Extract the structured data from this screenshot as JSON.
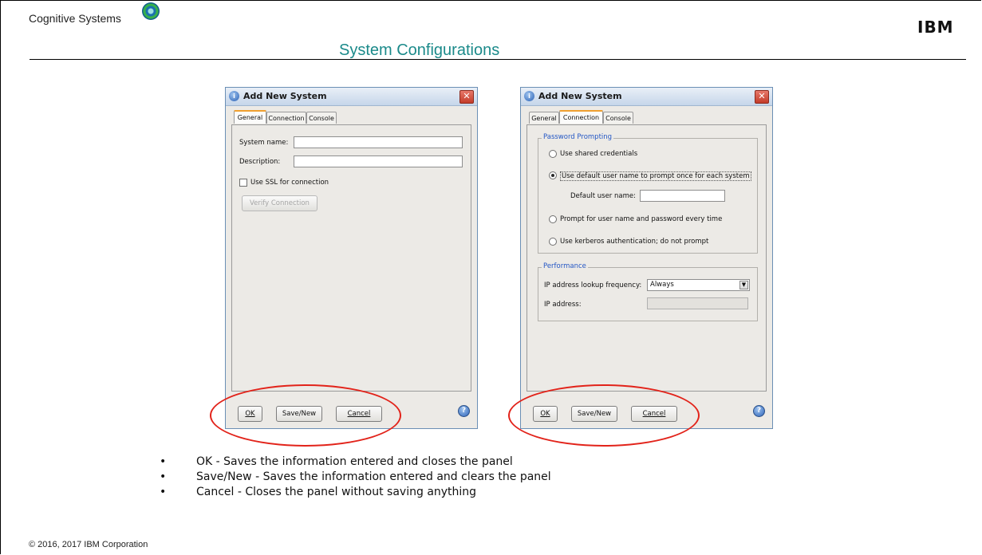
{
  "header": {
    "brand": "Cognitive Systems",
    "title": "System Configurations",
    "logo_text": "IBM"
  },
  "footer": {
    "copyright": "© 2016, 2017 IBM Corporation"
  },
  "dialogs": [
    {
      "title": "Add New System",
      "close_glyph": "✕",
      "tabs": [
        "General",
        "Connection",
        "Console"
      ],
      "active_tab": "General",
      "fields": {
        "system_name_label": "System name:",
        "system_name_value": "",
        "description_label": "Description:",
        "description_value": ""
      },
      "ssl_checkbox_label": "Use SSL for connection",
      "ssl_checked": false,
      "verify_button": "Verify Connection",
      "buttons": {
        "ok": "OK",
        "save_new": "Save/New",
        "cancel": "Cancel"
      }
    },
    {
      "title": "Add New System",
      "close_glyph": "✕",
      "tabs": [
        "General",
        "Connection",
        "Console"
      ],
      "active_tab": "Connection",
      "password_group": {
        "legend": "Password Prompting",
        "options": [
          "Use shared credentials",
          "Use default user name to prompt once for each system",
          "Prompt for user name and password every time",
          "Use kerberos authentication; do not prompt"
        ],
        "selected_index": 1,
        "default_user_label": "Default user name:",
        "default_user_value": ""
      },
      "performance_group": {
        "legend": "Performance",
        "lookup_label": "IP address lookup frequency:",
        "lookup_value": "Always",
        "ip_label": "IP address:",
        "ip_value": ""
      },
      "buttons": {
        "ok": "OK",
        "save_new": "Save/New",
        "cancel": "Cancel"
      }
    }
  ],
  "bullets": [
    "OK - Saves the information entered and closes the panel",
    "Save/New - Saves the information entered and clears the panel",
    "Cancel - Closes the panel without saving anything"
  ],
  "bullet_glyph": "•",
  "icons": {
    "help": "?",
    "dropdown": "▼",
    "info": "i"
  },
  "colors": {
    "title_teal": "#1b8a8a",
    "highlight_red": "#e2231a",
    "legend_blue": "#2457c5"
  }
}
